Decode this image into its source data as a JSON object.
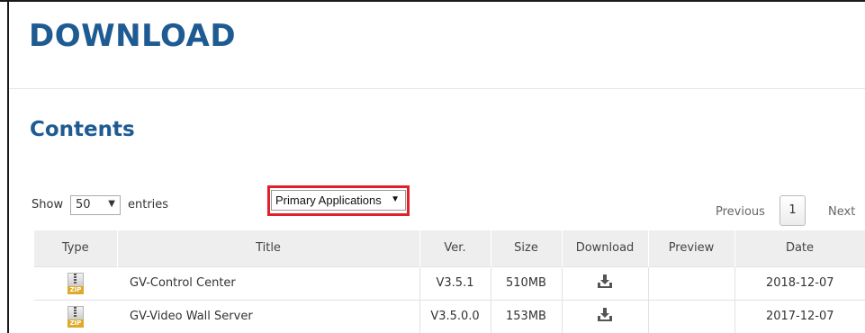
{
  "page": {
    "title": "DOWNLOAD"
  },
  "section": {
    "title": "Contents"
  },
  "controls": {
    "show_label": "Show",
    "entries_value": "50",
    "entries_label": "entries",
    "category_value": "Primary Applications"
  },
  "pager": {
    "previous": "Previous",
    "current_page": "1",
    "next": "Next"
  },
  "table": {
    "headers": {
      "type": "Type",
      "title": "Title",
      "version": "Ver.",
      "size": "Size",
      "download": "Download",
      "preview": "Preview",
      "date": "Date"
    },
    "rows": [
      {
        "type_icon": "zip-file-icon",
        "title": "GV-Control Center",
        "version": "V3.5.1",
        "size": "510MB",
        "download_icon": "download-icon",
        "preview": "",
        "date": "2018-12-07"
      },
      {
        "type_icon": "zip-file-icon",
        "title": "GV-Video Wall Server",
        "version": "V3.5.0.0",
        "size": "153MB",
        "download_icon": "download-icon",
        "preview": "",
        "date": "2017-12-07"
      }
    ]
  },
  "colors": {
    "heading": "#1f5b93",
    "highlight": "#e0202a",
    "header_bg": "#eeeeee"
  }
}
